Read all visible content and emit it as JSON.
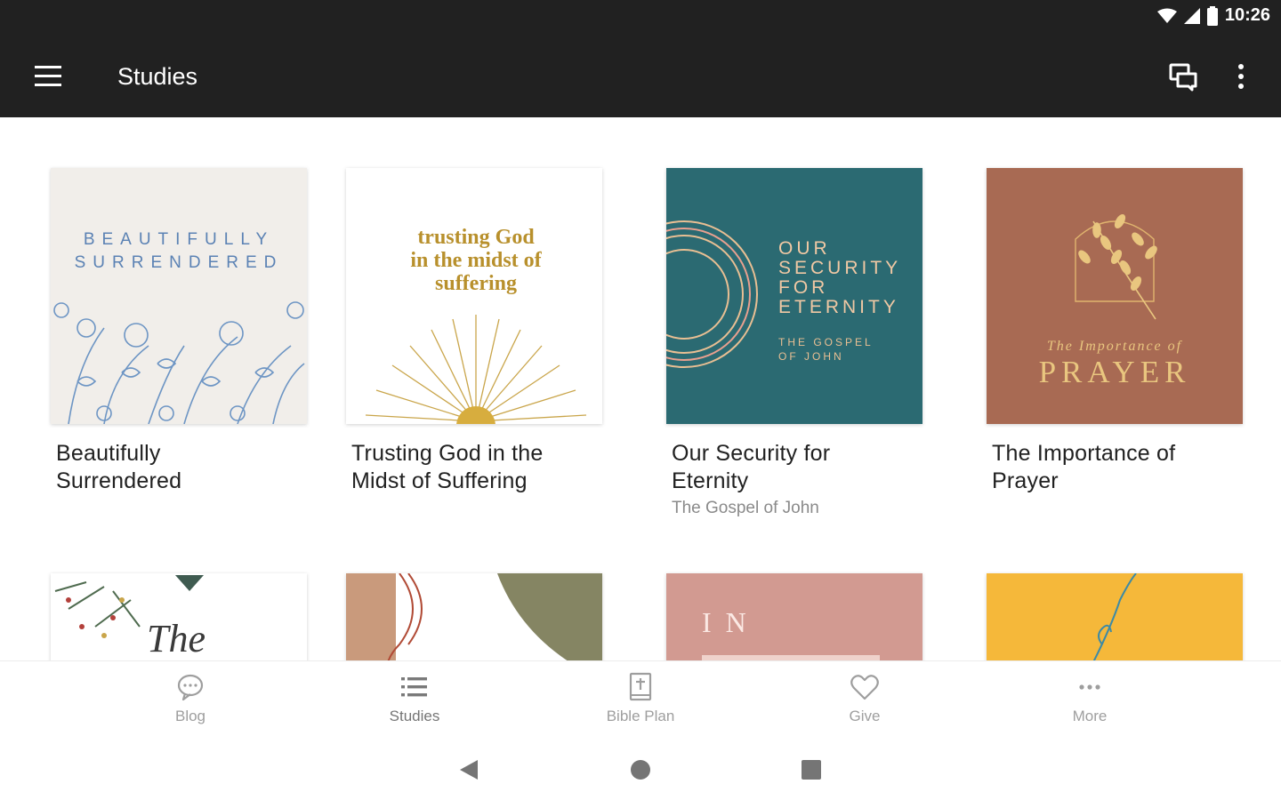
{
  "status_bar": {
    "time": "10:26"
  },
  "app_bar": {
    "title": "Studies"
  },
  "studies": [
    {
      "title_line1": "Beautifully",
      "title_line2": "Surrendered",
      "subtitle": "",
      "cover_text": [
        "BEAUTIFULLY",
        "SURRENDERED"
      ],
      "cover_color": "#f1eeea",
      "accent": "#5b82b4"
    },
    {
      "title_line1": "Trusting God in the",
      "title_line2": "Midst of Suffering",
      "subtitle": "",
      "cover_text": [
        "trusting God",
        "in the midst of",
        "suffering"
      ],
      "cover_color": "#ffffff",
      "accent": "#b8902c"
    },
    {
      "title_line1": "Our Security for",
      "title_line2": "Eternity",
      "subtitle": "The Gospel of John",
      "cover_text": [
        "OUR",
        "SECURITY",
        "FOR",
        "ETERNITY",
        "THE GOSPEL",
        "OF JOHN"
      ],
      "cover_color": "#2b6a72",
      "accent": "#e6b98e"
    },
    {
      "title_line1": "The Importance of",
      "title_line2": "Prayer",
      "subtitle": "",
      "cover_text": [
        "The Importance of",
        "PRAYER"
      ],
      "cover_color": "#a86a53",
      "accent": "#e9c67f"
    }
  ],
  "partial_covers": [
    {
      "text": "The",
      "cover_color": "#ffffff"
    },
    {
      "text": "",
      "cover_color": "#ffffff"
    },
    {
      "text": "IN",
      "cover_color": "#d29a91"
    },
    {
      "text": "",
      "cover_color": "#f5b83a"
    }
  ],
  "bottom_nav": [
    {
      "label": "Blog",
      "icon": "chat-bubble-icon"
    },
    {
      "label": "Studies",
      "icon": "list-icon"
    },
    {
      "label": "Bible Plan",
      "icon": "bible-icon"
    },
    {
      "label": "Give",
      "icon": "heart-icon"
    },
    {
      "label": "More",
      "icon": "more-horizontal-icon"
    }
  ]
}
